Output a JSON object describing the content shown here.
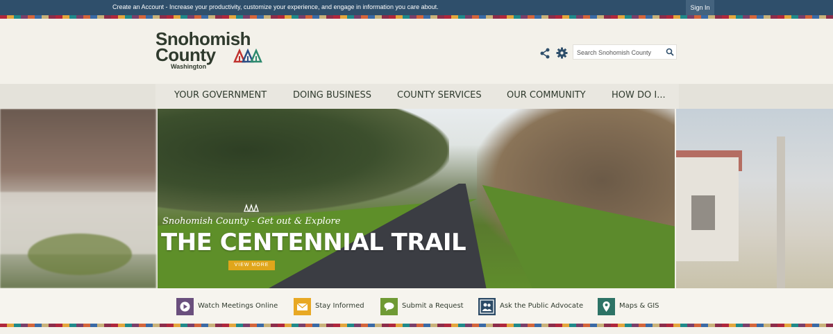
{
  "account_bar": {
    "message": "Create an Account - Increase your productivity, customize your experience, and engage in information you care about.",
    "sign_in_label": "Sign In"
  },
  "logo": {
    "line1": "Snohomish",
    "line2": "County",
    "line3": "Washington"
  },
  "header": {
    "icons": [
      "share-icon",
      "gear-icon",
      "search-icon"
    ],
    "search": {
      "placeholder": "Search Snohomish County",
      "value": ""
    }
  },
  "nav": {
    "items": [
      {
        "label": "YOUR GOVERNMENT"
      },
      {
        "label": "DOING BUSINESS"
      },
      {
        "label": "COUNTY SERVICES"
      },
      {
        "label": "OUR COMMUNITY"
      },
      {
        "label": "HOW DO I..."
      }
    ]
  },
  "hero": {
    "tagline": "Snohomish County - Get out & Explore",
    "headline": "THE CENTENNIAL TRAIL",
    "button_label": "VIEW MORE"
  },
  "quick_links": [
    {
      "label": "Watch Meetings Online",
      "icon": "play-icon",
      "color": "#6a4f7d"
    },
    {
      "label": "Stay Informed",
      "icon": "envelope-icon",
      "color": "#e8a823"
    },
    {
      "label": "Submit a Request",
      "icon": "speech-bubble-icon",
      "color": "#6f9a34"
    },
    {
      "label": "Ask the Public Advocate",
      "icon": "people-icon",
      "color": "#2c4a66"
    },
    {
      "label": "Maps & GIS",
      "icon": "map-pin-icon",
      "color": "#2d7366"
    }
  ],
  "colors": {
    "top_bar": "#2f4f6b",
    "header_bg": "#f3f1ea",
    "nav_bg": "#e9e7e0",
    "text_dark": "#2f3a2d",
    "accent_button": "#e0a61b"
  }
}
